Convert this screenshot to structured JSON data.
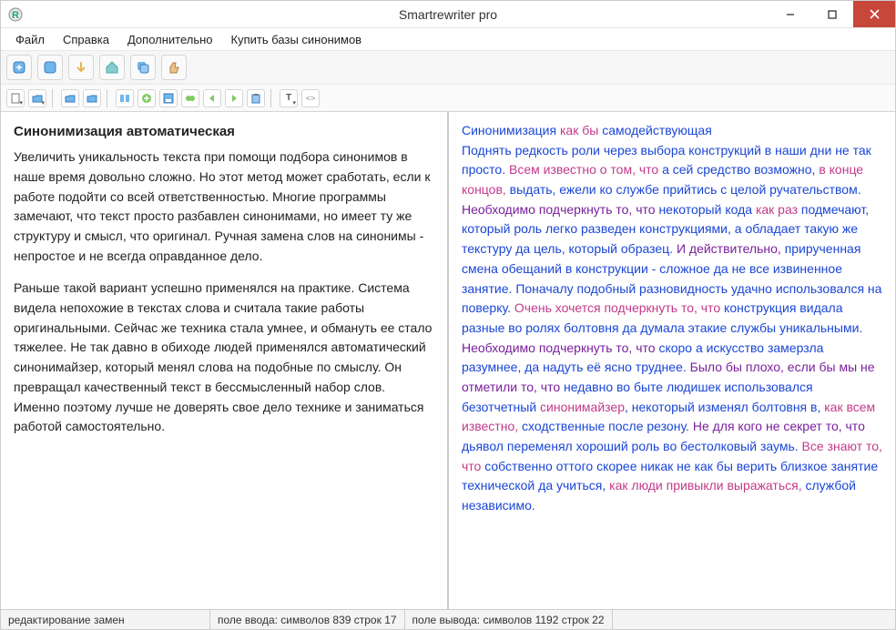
{
  "window": {
    "title": "Smartrewriter pro"
  },
  "menu": {
    "file": "Файл",
    "help": "Справка",
    "extra": "Дополнительно",
    "buy": "Купить базы синонимов"
  },
  "left": {
    "heading": "Синонимизация автоматическая",
    "p1": "Увеличить уникальность текста при помощи подбора синонимов в наше время довольно сложно. Но этот метод может сработать, если к работе подойти со всей ответственностью. Многие программы замечают, что текст просто разбавлен синонимами, но имеет ту же структуру и смысл, что оригинал. Ручная замена слов на синонимы - непростое и не всегда оправданное дело.",
    "p2": "Раньше такой вариант успешно применялся на практике. Система видела непохожие в текстах слова и считала такие работы оригинальными. Сейчас же техника стала умнее, и обмануть ее стало тяжелее. Не так давно в обиходе людей применялся автоматический синонимайзер, который менял слова на подобные по смыслу. Он превращал качественный текст в бессмысленный набор слов. Именно поэтому лучше не доверять свое дело технике и заниматься работой самостоятельно."
  },
  "right": {
    "segments": [
      {
        "c": "c1",
        "t": "Синонимизация "
      },
      {
        "c": "c2",
        "t": "как бы "
      },
      {
        "c": "c1",
        "t": "самодействующая\n"
      },
      {
        "c": "c1",
        "t": "Поднять редкость роли через выбора конструкций в наши дни не так просто. "
      },
      {
        "c": "c2",
        "t": "Всем известно о том, что "
      },
      {
        "c": "c1",
        "t": "а сей средство возможно, "
      },
      {
        "c": "c2",
        "t": "в конце концов, "
      },
      {
        "c": "c1",
        "t": "выдать, ежели ко службе прийтись с целой ручательством. "
      },
      {
        "c": "c3",
        "t": "Необходимо подчеркнуть то, что "
      },
      {
        "c": "c1",
        "t": "некоторый кода "
      },
      {
        "c": "c2",
        "t": "как раз "
      },
      {
        "c": "c1",
        "t": "подмечают, который роль легко разведен конструкциями, а обладает такую же текстуру да цель, который образец. "
      },
      {
        "c": "c3",
        "t": "И действительно, "
      },
      {
        "c": "c1",
        "t": "прирученная смена обещаний в конструкции - сложное да не все извиненное занятие. Поначалу подобный разновидность удачно использовался на поверку. "
      },
      {
        "c": "c2",
        "t": "Очень хочется подчеркнуть то, что "
      },
      {
        "c": "c1",
        "t": "конструкция видала разные во ролях болтовня да думала этакие службы уникальными. "
      },
      {
        "c": "c3",
        "t": "Необходимо подчеркнуть то, что "
      },
      {
        "c": "c1",
        "t": "скоро а искусство замерзла разумнее, да надуть её ясно труднее. "
      },
      {
        "c": "c3",
        "t": "Было бы плохо, если бы мы не отметили то, что "
      },
      {
        "c": "c1",
        "t": "недавно во быте людишек использовался безотчетный "
      },
      {
        "c": "c2",
        "t": "синонимайзер"
      },
      {
        "c": "c1",
        "t": ", некоторый изменял болтовня в, "
      },
      {
        "c": "c2",
        "t": "как всем известно, "
      },
      {
        "c": "c1",
        "t": "сходственные после резону. "
      },
      {
        "c": "c3",
        "t": "Не для кого не секрет то, что "
      },
      {
        "c": "c1",
        "t": "дьявол переменял хороший роль во бестолковый заумь. "
      },
      {
        "c": "c2",
        "t": "Все знают то, что "
      },
      {
        "c": "c1",
        "t": "собственно оттого скорее никак не как бы верить близкое занятие технической да учиться, "
      },
      {
        "c": "c2",
        "t": "как люди привыкли выражаться, "
      },
      {
        "c": "c1",
        "t": "службой независимо."
      }
    ]
  },
  "status": {
    "cell1": "редактирование замен",
    "cell2": "поле ввода: символов 839 строк 17",
    "cell3": "поле вывода: символов 1192 строк 22"
  }
}
